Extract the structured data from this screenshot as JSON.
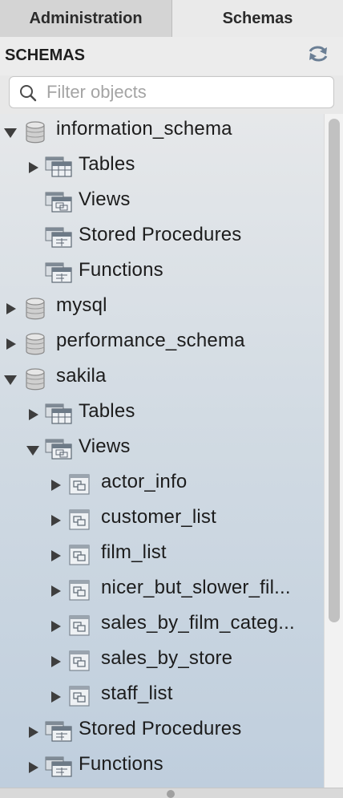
{
  "tabs": {
    "administration": "Administration",
    "schemas": "Schemas"
  },
  "header": {
    "title": "SCHEMAS",
    "refresh_icon": "refresh-icon"
  },
  "search": {
    "placeholder": "Filter objects",
    "value": ""
  },
  "tree": {
    "information_schema": {
      "label": "information_schema",
      "tables": "Tables",
      "views": "Views",
      "stored_procedures": "Stored Procedures",
      "functions": "Functions"
    },
    "mysql": {
      "label": "mysql"
    },
    "performance_schema": {
      "label": "performance_schema"
    },
    "sakila": {
      "label": "sakila",
      "tables": "Tables",
      "views": "Views",
      "view_items": [
        "actor_info",
        "customer_list",
        "film_list",
        "nicer_but_slower_fil...",
        "sales_by_film_categ...",
        "sales_by_store",
        "staff_list"
      ],
      "stored_procedures": "Stored Procedures",
      "functions": "Functions"
    }
  }
}
